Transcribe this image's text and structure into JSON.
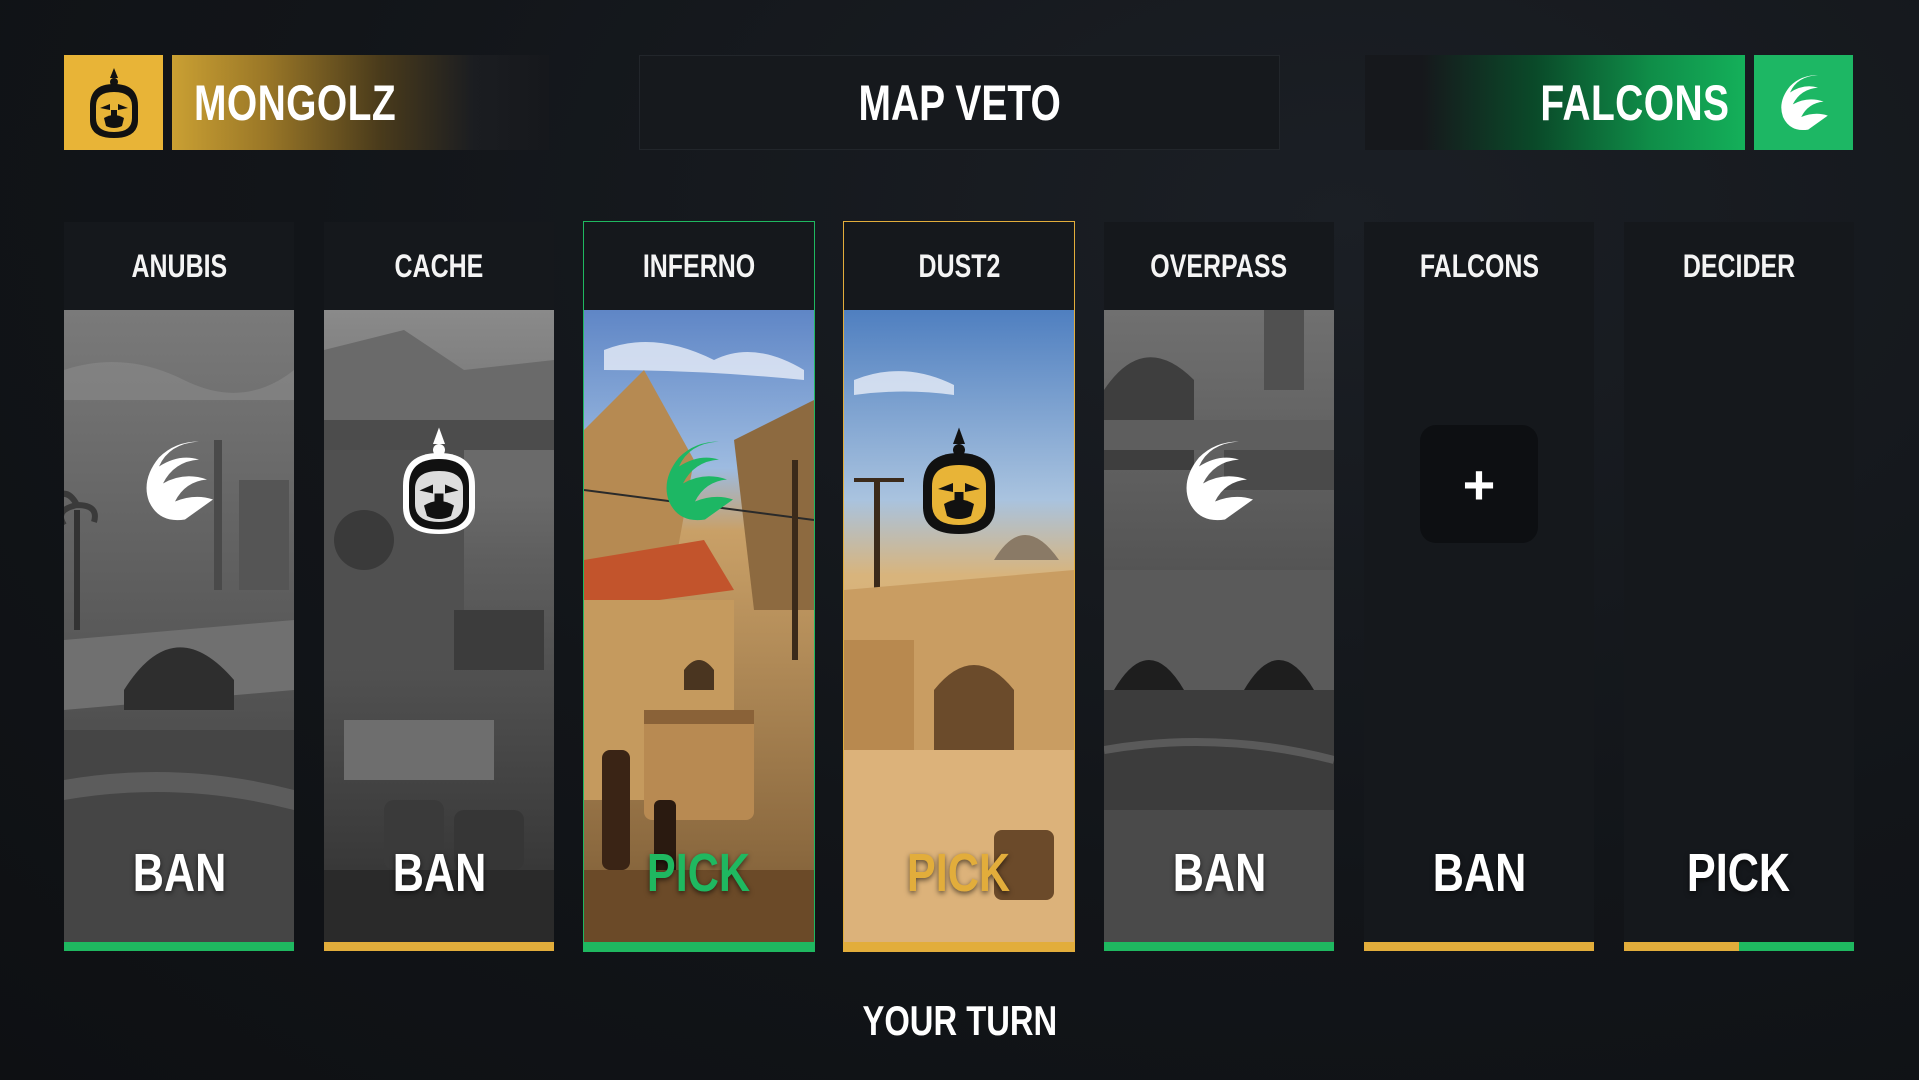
{
  "header": {
    "left_team": {
      "name": "MONGOLZ",
      "logo_icon": "mongolz-logo-icon",
      "color": "#e8b437"
    },
    "title": "MAP VETO",
    "right_team": {
      "name": "FALCONS",
      "logo_icon": "falcons-logo-icon",
      "color": "#1db764"
    }
  },
  "maps": [
    {
      "name": "ANUBIS",
      "action": "BAN",
      "team_icon": "falcons-logo-icon",
      "status_color": "#1fb860"
    },
    {
      "name": "CACHE",
      "action": "BAN",
      "team_icon": "mongolz-logo-icon",
      "status_color": "#e2ad3b"
    },
    {
      "name": "INFERNO",
      "action": "PICK",
      "team_icon": "falcons-logo-icon",
      "status_color": "#1fb860"
    },
    {
      "name": "DUST2",
      "action": "PICK",
      "team_icon": "mongolz-logo-icon",
      "status_color": "#e2ad3b"
    },
    {
      "name": "OVERPASS",
      "action": "BAN",
      "team_icon": "falcons-logo-icon",
      "status_color": "#1fb860"
    },
    {
      "name": "FALCONS",
      "action": "BAN",
      "team_icon": "plus-icon",
      "status_color": "#e2ad3b"
    },
    {
      "name": "DECIDER",
      "action": "PICK",
      "team_icon": "none",
      "status_color": "#e2ad3b / #1fb860"
    }
  ],
  "plus_symbol": "+",
  "footer": {
    "status": "YOUR TURN"
  }
}
